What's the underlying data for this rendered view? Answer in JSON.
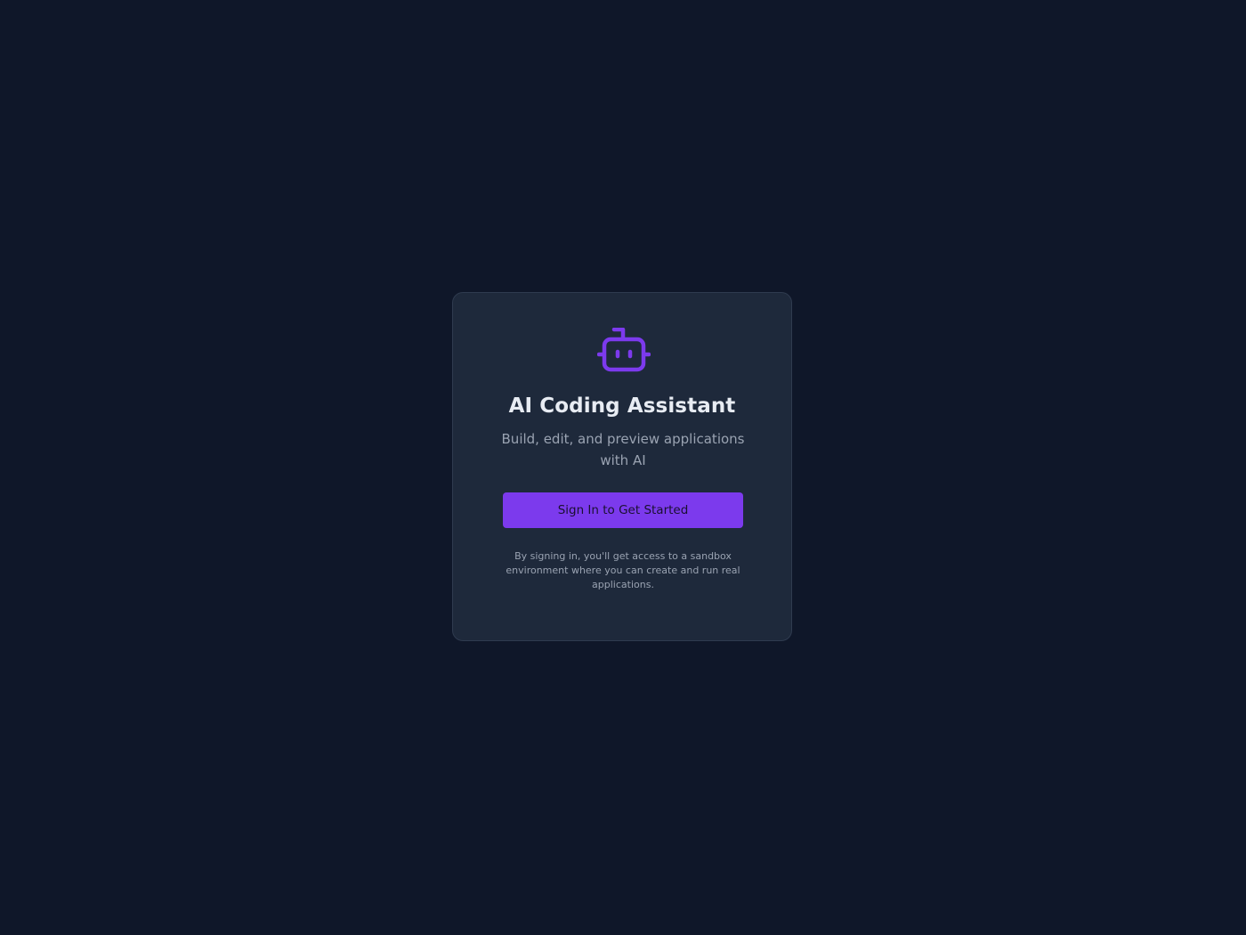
{
  "accent_color": "#7c3aed",
  "background_color": "#0f1729",
  "card": {
    "icon": "robot-icon",
    "title": "AI Coding Assistant",
    "subtitle": "Build, edit, and preview applications with AI",
    "sign_in_label": "Sign In to Get Started",
    "note": "By signing in, you'll get access to a sandbox environment where you can create and run real applications."
  }
}
